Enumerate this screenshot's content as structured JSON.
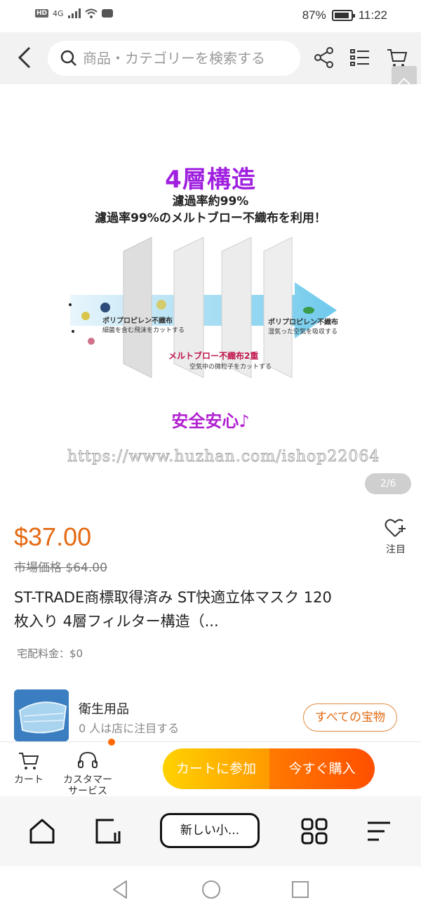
{
  "status_bar": {
    "network_label": "HD",
    "network_type": "4G",
    "battery": "87%",
    "time": "11:22"
  },
  "top_nav": {
    "search_placeholder": "商品・カテゴリーを検索する"
  },
  "hero_image": {
    "heading": "4層構造",
    "line1": "濾過率約99%",
    "line2": "濾過率99%のメルトブロー不織布を利用！",
    "layer_left_title": "ポリプロピレン不織布",
    "layer_left_sub": "細菌を含む飛沫をカットする",
    "layer_mid_title": "メルトブロー不織布2重",
    "layer_mid_sub": "空気中の微粒子をカットする",
    "layer_right_title": "ポリプロピレン不織布",
    "layer_right_sub": "湿気った空気を吸収する",
    "footer": "安全安心♪",
    "watermark": "https://www.huzhan.com/ishop22064",
    "pager": "2/6"
  },
  "product": {
    "price": "$37.00",
    "market_label": "市場価格",
    "market_price": "$64.00",
    "favorite_label": "注目",
    "title": "ST-TRADE商標取得済み ST快適立体マスク 120枚入り 4層フィルター構造（...",
    "shipping": "宅配料金：$0"
  },
  "shop": {
    "name": "衛生用品",
    "followers": "0 人は店に注目する",
    "all_items_button": "すべての宝物"
  },
  "action_bar": {
    "cart_label": "カート",
    "service_label_1": "カスタマー",
    "service_label_2": "サービス",
    "add_to_cart": "カートに参加",
    "buy_now": "今すぐ購入"
  },
  "browser_bar": {
    "tab_label": "新しい小..."
  },
  "colors": {
    "price": "#e46a14",
    "accent_orange": "#ff6a00",
    "heading_purple": "#a020e0"
  }
}
